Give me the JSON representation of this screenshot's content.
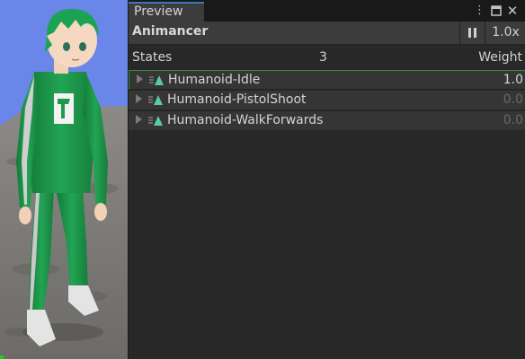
{
  "preview": {
    "tab_label": "Preview",
    "menu_icon": "kebab-menu-icon",
    "maximize_icon": "maximize-icon",
    "close_icon": "close-icon"
  },
  "toolbar": {
    "title": "Animancer",
    "pause_icon": "pause-icon",
    "speed": "1.0x"
  },
  "states": {
    "label": "States",
    "count": "3",
    "weight_label": "Weight",
    "items": [
      {
        "name": "Humanoid-Idle",
        "weight": "1.0",
        "active": true
      },
      {
        "name": "Humanoid-PistolShoot",
        "weight": "0.0",
        "active": false
      },
      {
        "name": "Humanoid-WalkForwards",
        "weight": "0.0",
        "active": false
      }
    ]
  },
  "colors": {
    "tab_accent": "#3a79bb",
    "state_icon": "#5cc8a4",
    "selected_outline": "#3c8a3c",
    "character_suit": "#1f9a4c",
    "sky": "#6a86e8"
  }
}
